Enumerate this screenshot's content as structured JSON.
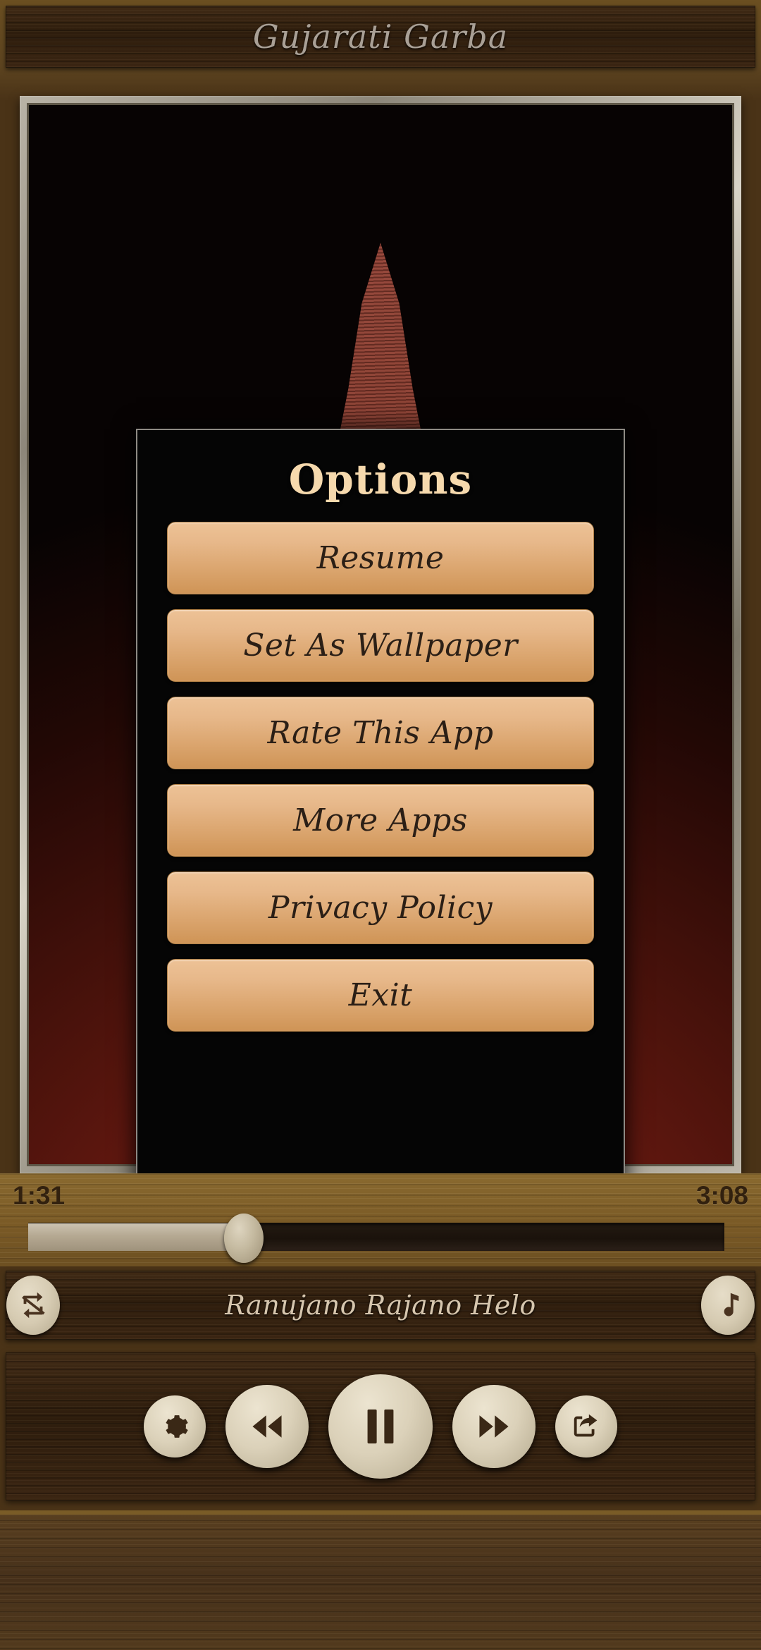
{
  "app": {
    "title": "Gujarati Garba"
  },
  "artwork": {
    "alt": "garba-devotional-artwork"
  },
  "dialog": {
    "title": "Options",
    "buttons": [
      {
        "label": "Resume",
        "name": "resume"
      },
      {
        "label": "Set As Wallpaper",
        "name": "set-as-wallpaper"
      },
      {
        "label": "Rate This App",
        "name": "rate-this-app"
      },
      {
        "label": "More Apps",
        "name": "more-apps"
      },
      {
        "label": "Privacy Policy",
        "name": "privacy-policy"
      },
      {
        "label": "Exit",
        "name": "exit"
      }
    ]
  },
  "player": {
    "current_time": "1:31",
    "total_time": "3:08",
    "progress_percent": 31,
    "song_title": "Ranujano Rajano Helo",
    "repeat_icon": "repeat-off-icon",
    "playlist_icon": "music-note-icon",
    "controls": [
      {
        "name": "settings",
        "icon": "gear-icon"
      },
      {
        "name": "previous",
        "icon": "rewind-icon"
      },
      {
        "name": "play-pause",
        "icon": "pause-icon"
      },
      {
        "name": "next",
        "icon": "fast-forward-icon"
      },
      {
        "name": "share",
        "icon": "share-icon"
      }
    ]
  },
  "colors": {
    "accent_button": "#dca771",
    "dialog_title": "#f6d9ad",
    "wood_dark": "#33200f",
    "wood_mid": "#4a3317",
    "artwork_red": "#8e2218"
  }
}
